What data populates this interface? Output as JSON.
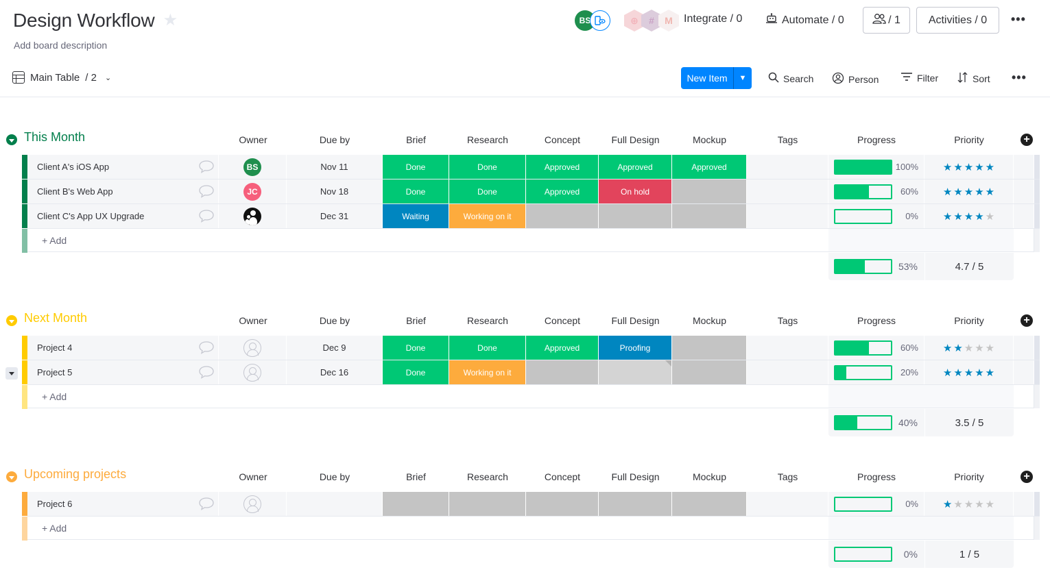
{
  "header": {
    "title": "Design Workflow",
    "description": "Add board description",
    "owner_avatar_initials": "BS",
    "integrate_label": "Integrate / 0",
    "automate_label": "Automate / 0",
    "members_label": "/ 1",
    "activities_label": "Activities / 0",
    "integration_icons": [
      "twilio-icon",
      "slack-icon",
      "gmail-icon"
    ]
  },
  "toolbar": {
    "view_label": "Main Table",
    "view_count": "/ 2",
    "new_item_label": "New Item",
    "search_label": "Search",
    "person_label": "Person",
    "filter_label": "Filter",
    "sort_label": "Sort"
  },
  "colors": {
    "done": "#00c875",
    "approved": "#00c875",
    "waiting": "#0086c0",
    "proofing": "#0086c0",
    "working": "#fdab3d",
    "on_hold": "#e2445c",
    "empty": "#c4c4c4",
    "group_this_month": "#037f4c",
    "group_next_month": "#ffcb00",
    "group_upcoming": "#fdab3d",
    "star_on": "#0086c0",
    "primary": "#0085ff"
  },
  "columns": {
    "owner": "Owner",
    "due": "Due by",
    "brief": "Brief",
    "research": "Research",
    "concept": "Concept",
    "fulldesign": "Full Design",
    "mockup": "Mockup",
    "tags": "Tags",
    "progress": "Progress",
    "priority": "Priority"
  },
  "add_label": "+ Add",
  "groups": [
    {
      "title": "This Month",
      "color": "#037f4c",
      "add_color": "#81bfa5",
      "rows": [
        {
          "name": "Client A's iOS App",
          "owner": {
            "type": "initials",
            "initials": "BS",
            "color": "#1f8f4e"
          },
          "due": "Nov 11",
          "brief": "Done",
          "research": "Done",
          "concept": "Approved",
          "fulldesign": "Approved",
          "mockup": "Approved",
          "progress": 100,
          "progress_label": "100%",
          "priority": 5
        },
        {
          "name": "Client B's Web App",
          "owner": {
            "type": "initials",
            "initials": "JC",
            "color": "#f65f7c"
          },
          "due": "Nov 18",
          "brief": "Done",
          "research": "Done",
          "concept": "Approved",
          "fulldesign": "On hold",
          "mockup": "",
          "progress": 60,
          "progress_label": "60%",
          "priority": 5
        },
        {
          "name": "Client C's App UX Upgrade",
          "owner": {
            "type": "team"
          },
          "due": "Dec 31",
          "brief": "Waiting",
          "research": "Working on it",
          "concept": "",
          "fulldesign": "",
          "mockup": "",
          "progress": 0,
          "progress_label": "0%",
          "priority": 4
        }
      ],
      "summary": {
        "progress": 53,
        "progress_label": "53%",
        "priority_label": "4.7 / 5"
      }
    },
    {
      "title": "Next Month",
      "color": "#ffcb00",
      "add_color": "#ffe580",
      "rows": [
        {
          "name": "Project 4",
          "owner": {
            "type": "empty"
          },
          "due": "Dec 9",
          "brief": "Done",
          "research": "Done",
          "concept": "Approved",
          "fulldesign": "Proofing",
          "mockup": "",
          "progress": 60,
          "progress_label": "60%",
          "priority": 2
        },
        {
          "name": "Project 5",
          "owner": {
            "type": "empty"
          },
          "due": "Dec 16",
          "brief": "Done",
          "research": "Working on it",
          "concept": "",
          "fulldesign": "",
          "mockup": "",
          "progress": 20,
          "progress_label": "20%",
          "priority": 5
        }
      ],
      "summary": {
        "progress": 40,
        "progress_label": "40%",
        "priority_label": "3.5 / 5"
      }
    },
    {
      "title": "Upcoming projects",
      "color": "#fdab3d",
      "add_color": "#fed59e",
      "rows": [
        {
          "name": "Project 6",
          "owner": {
            "type": "empty"
          },
          "due": "",
          "brief": "",
          "research": "",
          "concept": "",
          "fulldesign": "",
          "mockup": "",
          "progress": 0,
          "progress_label": "0%",
          "priority": 1
        }
      ],
      "summary": {
        "progress": 0,
        "progress_label": "0%",
        "priority_label": "1 / 5"
      }
    }
  ]
}
